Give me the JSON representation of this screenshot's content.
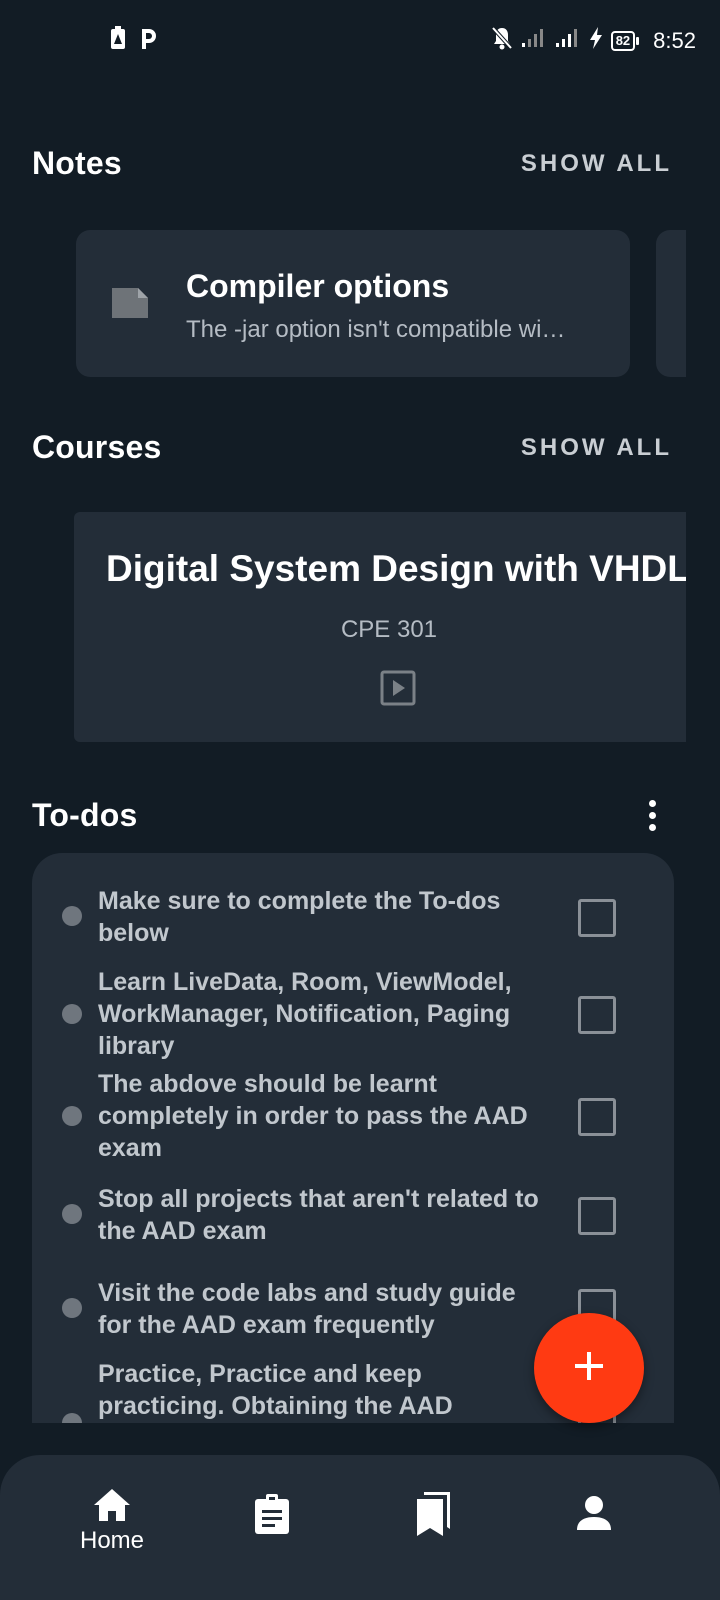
{
  "status_bar": {
    "time": "8:52",
    "battery": "82",
    "left_icons": [
      "battery-saver-icon",
      "parking-app-icon"
    ],
    "right_icons": [
      "bell-off-icon",
      "signal-1-icon",
      "signal-2-icon",
      "charging-icon"
    ]
  },
  "notes": {
    "title": "Notes",
    "show_all": "SHOW ALL",
    "items": [
      {
        "title": "Compiler options",
        "snippet": "The -jar option isn't compatible wi…",
        "icon": "note-icon"
      }
    ]
  },
  "courses": {
    "title": "Courses",
    "show_all": "SHOW ALL",
    "items": [
      {
        "title": "Digital System Design with VHDL",
        "code": "CPE 301",
        "icon": "play-icon"
      }
    ]
  },
  "todos": {
    "title": "To-dos",
    "items": [
      {
        "text": "Make sure to complete the To-dos below",
        "checked": false
      },
      {
        "text": "Learn LiveData, Room, ViewModel, WorkManager, Notification, Paging library",
        "checked": false
      },
      {
        "text": "The abdove should be learnt completely in order to pass the AAD exam",
        "checked": false
      },
      {
        "text": "Stop all projects that aren't related to the AAD exam",
        "checked": false
      },
      {
        "text": "Visit the code labs and study guide for the AAD exam frequently",
        "checked": false
      },
      {
        "text": "Practice, Practice and keep practicing. Obtaining the AAD",
        "checked": false
      }
    ]
  },
  "fab": {
    "icon": "plus-icon"
  },
  "bottom_nav": {
    "items": [
      {
        "label": "Home",
        "icon": "home-icon",
        "active": true
      },
      {
        "label": "",
        "icon": "assignment-icon",
        "active": false
      },
      {
        "label": "",
        "icon": "bookmarks-icon",
        "active": false
      },
      {
        "label": "",
        "icon": "person-icon",
        "active": false
      }
    ]
  },
  "colors": {
    "background": "#121c25",
    "card": "#232d38",
    "accent": "#ff3a12",
    "text_primary": "#ffffff",
    "text_secondary": "#b5bcc4"
  }
}
